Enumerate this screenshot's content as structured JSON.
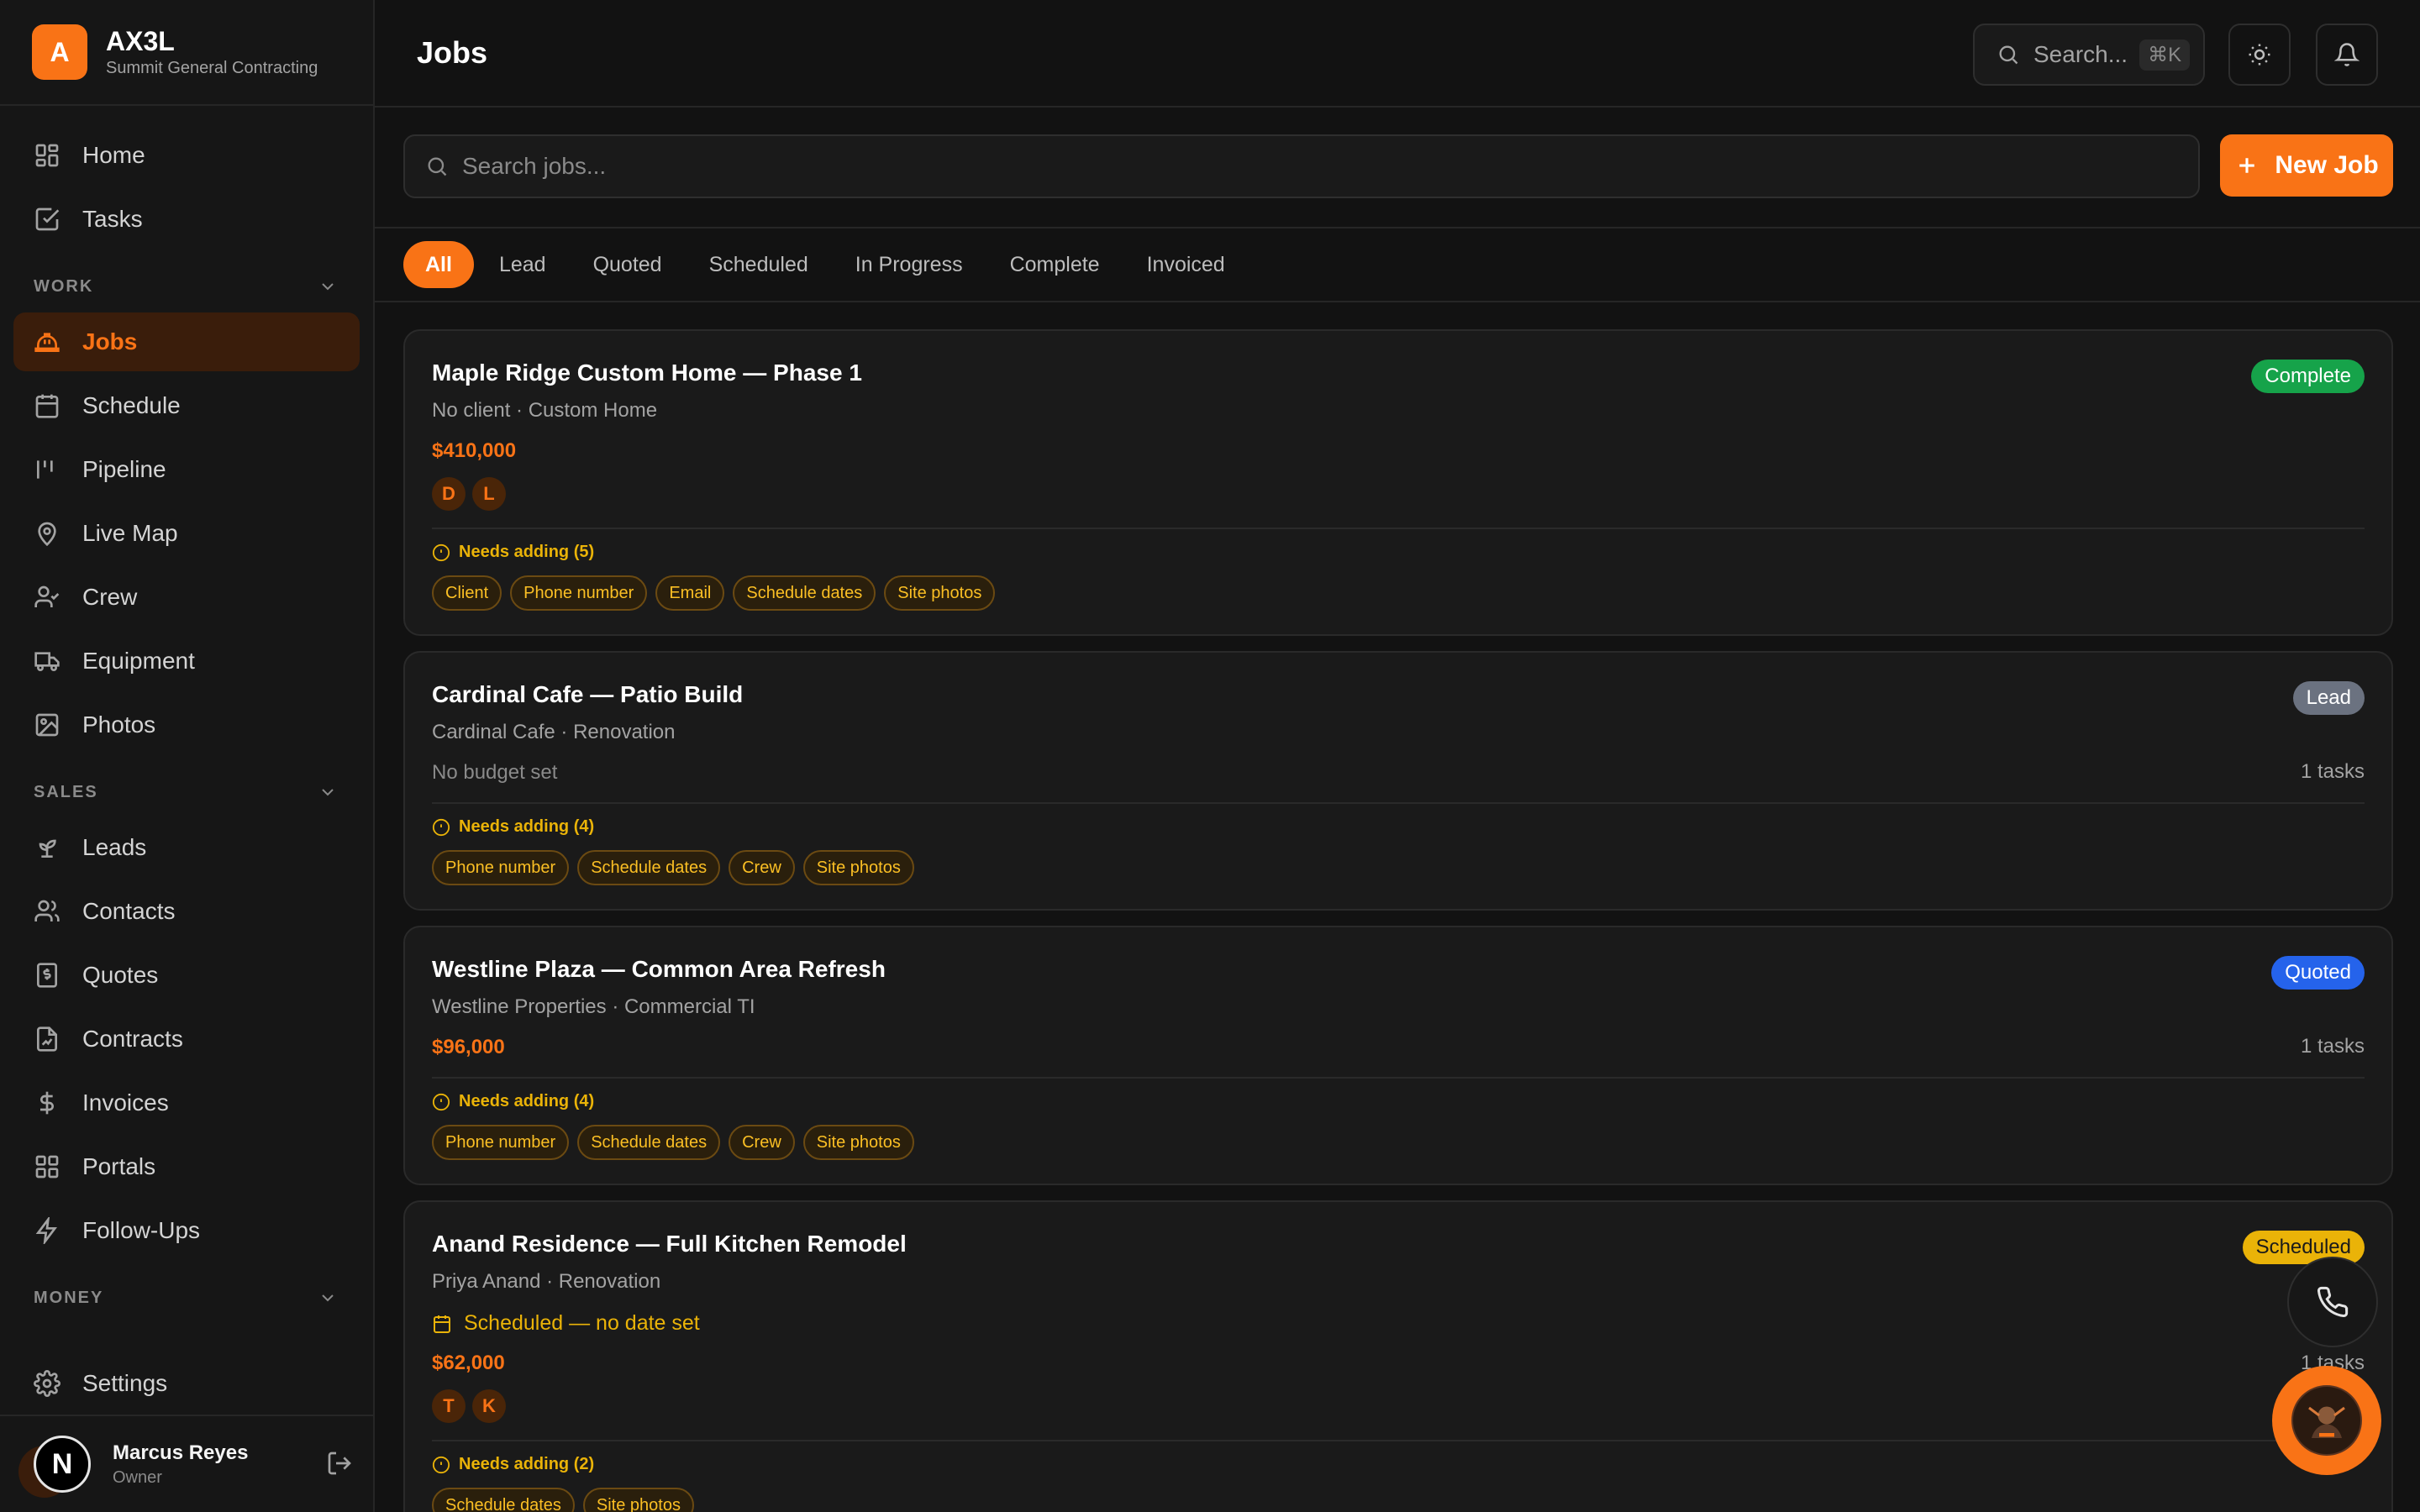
{
  "brand": {
    "logo_letter": "A",
    "name": "AX3L",
    "company": "Summit General Contracting"
  },
  "nav_top": [
    {
      "label": "Home",
      "icon": "home-grid-icon"
    },
    {
      "label": "Tasks",
      "icon": "check-square-icon"
    }
  ],
  "sections": {
    "work": "WORK",
    "sales": "SALES",
    "money": "MONEY"
  },
  "nav_work": [
    {
      "label": "Jobs",
      "icon": "hard-hat-icon",
      "active": true
    },
    {
      "label": "Schedule",
      "icon": "calendar-icon"
    },
    {
      "label": "Pipeline",
      "icon": "pipeline-icon"
    },
    {
      "label": "Live Map",
      "icon": "map-pin-icon"
    },
    {
      "label": "Crew",
      "icon": "user-check-icon"
    },
    {
      "label": "Equipment",
      "icon": "truck-icon"
    },
    {
      "label": "Photos",
      "icon": "image-icon"
    }
  ],
  "nav_sales": [
    {
      "label": "Leads",
      "icon": "sprout-icon"
    },
    {
      "label": "Contacts",
      "icon": "users-icon"
    },
    {
      "label": "Quotes",
      "icon": "receipt-icon"
    },
    {
      "label": "Contracts",
      "icon": "file-signature-icon"
    },
    {
      "label": "Invoices",
      "icon": "dollar-icon"
    },
    {
      "label": "Portals",
      "icon": "grid-icon"
    },
    {
      "label": "Follow-Ups",
      "icon": "zap-icon"
    }
  ],
  "settings_label": "Settings",
  "user": {
    "initial": "N",
    "name": "Marcus Reyes",
    "role": "Owner"
  },
  "header": {
    "title": "Jobs",
    "search_placeholder": "Search...",
    "shortcut": "⌘K"
  },
  "toolbar": {
    "search_placeholder": "Search jobs...",
    "new_job_label": "New Job"
  },
  "tabs": [
    "All",
    "Lead",
    "Quoted",
    "Scheduled",
    "In Progress",
    "Complete",
    "Invoiced"
  ],
  "colors": {
    "accent": "#f97316",
    "complete": "#16a34a",
    "lead": "#6b7280",
    "quoted": "#2563eb",
    "scheduled": "#eab308"
  },
  "jobs": [
    {
      "title": "Maple Ridge Custom Home — Phase 1",
      "subtitle": "No client · Custom Home",
      "amount": "$410,000",
      "status": "Complete",
      "initials": [
        "D",
        "L"
      ],
      "needs": "Needs adding (5)",
      "chips": [
        "Client",
        "Phone number",
        "Email",
        "Schedule dates",
        "Site photos"
      ]
    },
    {
      "title": "Cardinal Cafe — Patio Build",
      "subtitle": "Cardinal Cafe · Renovation",
      "no_budget": "No budget set",
      "tasks": "1 tasks",
      "status": "Lead",
      "needs": "Needs adding (4)",
      "chips": [
        "Phone number",
        "Schedule dates",
        "Crew",
        "Site photos"
      ]
    },
    {
      "title": "Westline Plaza — Common Area Refresh",
      "subtitle": "Westline Properties · Commercial TI",
      "amount": "$96,000",
      "tasks": "1 tasks",
      "status": "Quoted",
      "needs": "Needs adding (4)",
      "chips": [
        "Phone number",
        "Schedule dates",
        "Crew",
        "Site photos"
      ]
    },
    {
      "title": "Anand Residence — Full Kitchen Remodel",
      "subtitle": "Priya Anand · Renovation",
      "schedule_note": "Scheduled — no date set",
      "amount": "$62,000",
      "tasks": "1 tasks",
      "status": "Scheduled",
      "initials": [
        "T",
        "K"
      ],
      "needs": "Needs adding (2)",
      "chips": [
        "Schedule dates",
        "Site photos"
      ]
    }
  ]
}
